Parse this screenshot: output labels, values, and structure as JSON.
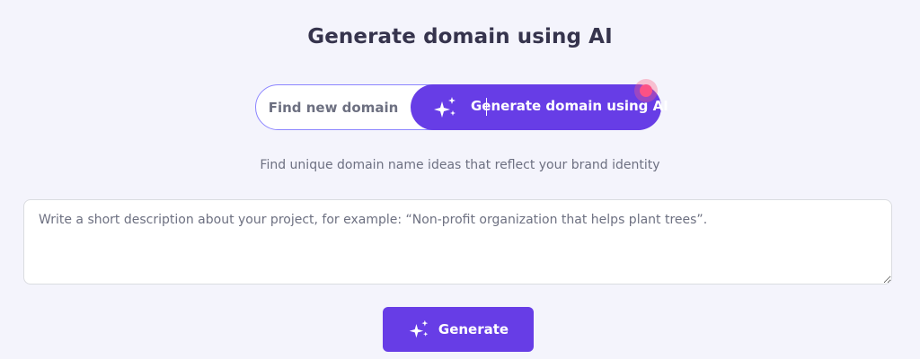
{
  "page": {
    "title": "Generate domain using AI"
  },
  "toggle": {
    "find_label": "Find new domain",
    "ai_label": "Generate domain using AI",
    "active": "ai"
  },
  "subtitle": "Find unique domain name ideas that reflect your brand identity",
  "description_input": {
    "placeholder": "Write a short description about your project, for example: “Non-profit organization that helps plant trees”.",
    "value": ""
  },
  "generate_button": {
    "label": "Generate",
    "icon": "sparkles-icon"
  },
  "colors": {
    "background": "#f4f4fc",
    "primary": "#673de6",
    "border": "#8c85ff",
    "notification": "#fc5185",
    "text_muted": "#6d7081"
  }
}
